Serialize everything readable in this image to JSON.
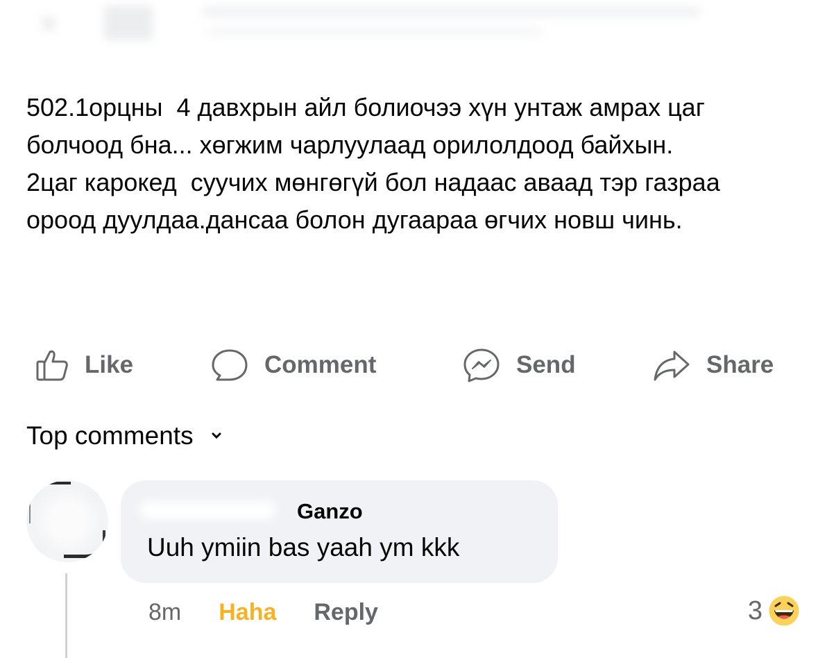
{
  "post": {
    "lines": [
      "502.1орцны  4 давхрын айл болиочээ хүн унтаж амрах цаг болчоод бна... хөгжим чарлуулаад орилолдоод байхын.",
      "2цаг карокед  суучих мөнгөгүй бол надаас аваад тэр газраа ороод дуулдаа.дансаа болон дугаараа өгчих новш чинь."
    ]
  },
  "actions": {
    "like": {
      "label": "Like",
      "icon": "thumbs-up-icon"
    },
    "comment": {
      "label": "Comment",
      "icon": "comment-bubble-icon"
    },
    "send": {
      "label": "Send",
      "icon": "messenger-icon"
    },
    "share": {
      "label": "Share",
      "icon": "share-arrow-icon"
    }
  },
  "comments_header": {
    "label": "Top comments",
    "icon": "chevron-down-icon"
  },
  "comment": {
    "author": "Ganzo",
    "text": "Uuh ymiin bas yaah ym kkk",
    "time": "8m",
    "reaction_label": "Haha",
    "reply_label": "Reply",
    "reaction_count": "3",
    "reaction_icon": "haha-emoji-icon"
  },
  "colors": {
    "text": "#050505",
    "secondary": "#65676b",
    "bubble": "#f0f2f5",
    "haha": "#f7b125"
  }
}
